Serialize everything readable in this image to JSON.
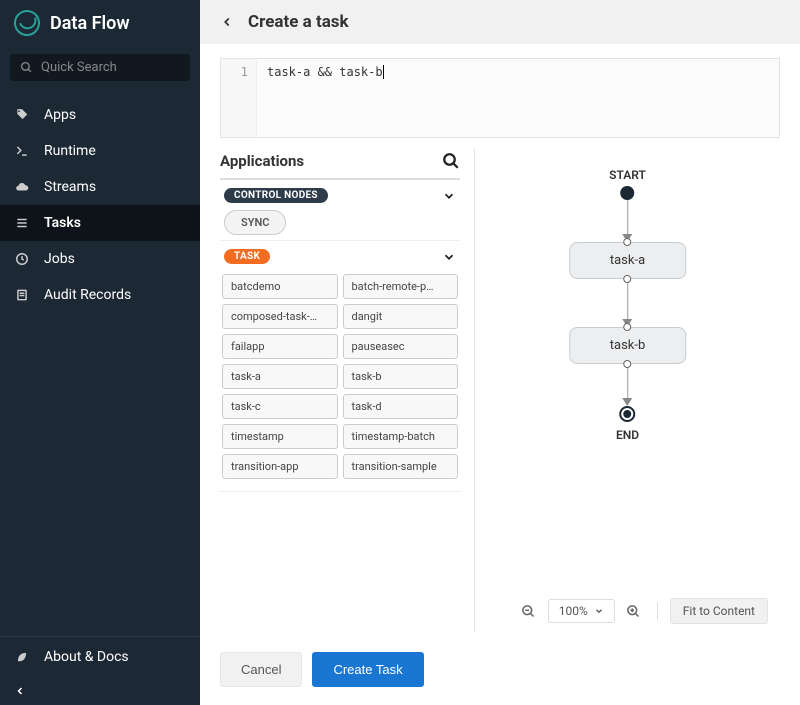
{
  "brand": {
    "name": "Data Flow"
  },
  "search": {
    "placeholder": "Quick Search"
  },
  "nav": {
    "items": [
      {
        "label": "Apps",
        "icon": "tag-icon"
      },
      {
        "label": "Runtime",
        "icon": "terminal-icon"
      },
      {
        "label": "Streams",
        "icon": "cloud-icon"
      },
      {
        "label": "Tasks",
        "icon": "list-icon",
        "active": true
      },
      {
        "label": "Jobs",
        "icon": "clock-icon"
      },
      {
        "label": "Audit Records",
        "icon": "clipboard-icon"
      }
    ],
    "footer": {
      "label": "About & Docs"
    }
  },
  "header": {
    "title": "Create a task"
  },
  "editor": {
    "line_no": "1",
    "code": "task-a && task-b"
  },
  "palette": {
    "title": "Applications",
    "control_label": "CONTROL NODES",
    "sync_label": "SYNC",
    "task_label": "TASK",
    "tasks": [
      "batcdemo",
      "batch-remote-p…",
      "composed-task-…",
      "dangit",
      "failapp",
      "pauseasec",
      "task-a",
      "task-b",
      "task-c",
      "task-d",
      "timestamp",
      "timestamp-batch",
      "transition-app",
      "transition-sample"
    ]
  },
  "flow": {
    "start_label": "START",
    "end_label": "END",
    "nodes": [
      "task-a",
      "task-b"
    ]
  },
  "tools": {
    "zoom": "100%",
    "fit": "Fit to Content"
  },
  "footer": {
    "cancel": "Cancel",
    "create": "Create Task"
  }
}
